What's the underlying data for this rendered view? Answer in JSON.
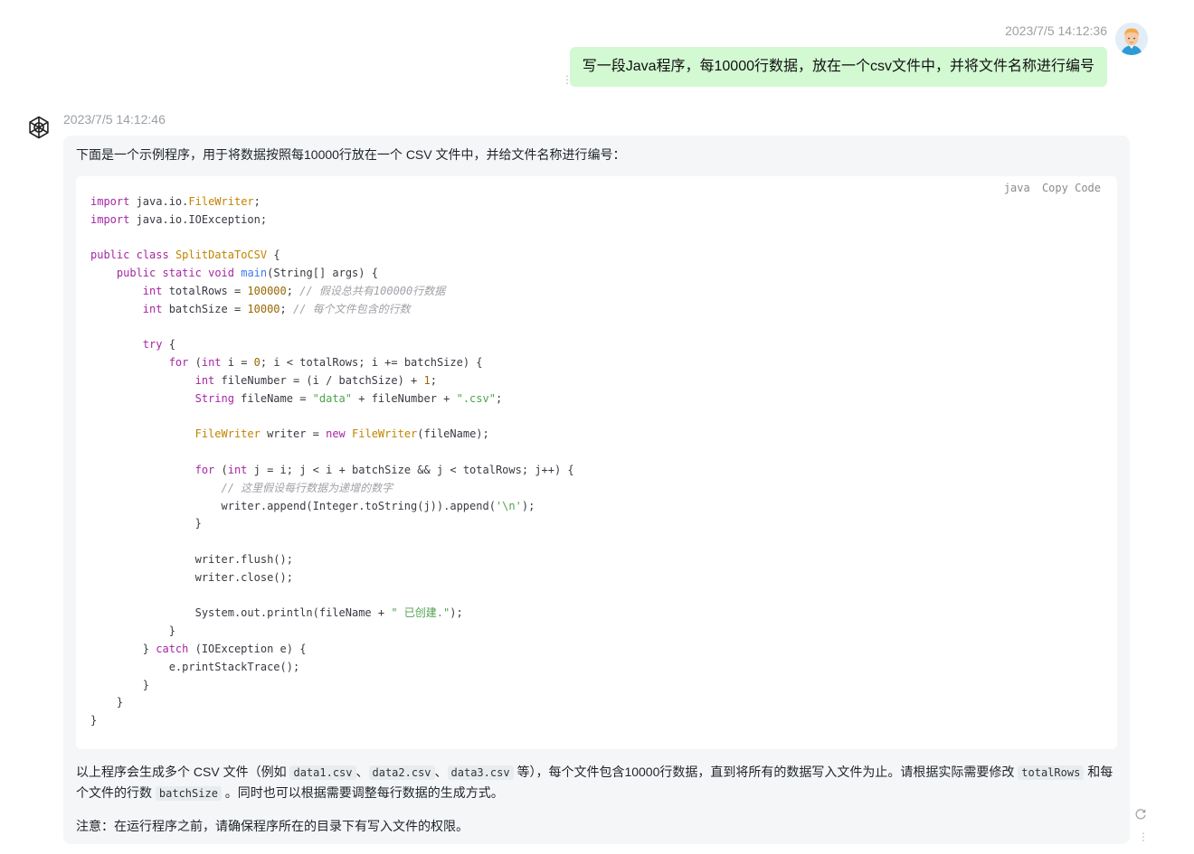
{
  "user_message": {
    "timestamp": "2023/7/5 14:12:36",
    "text": "写一段Java程序，每10000行数据，放在一个csv文件中，并将文件名称进行编号"
  },
  "assistant_message": {
    "timestamp": "2023/7/5 14:12:46",
    "intro": "下面是一个示例程序，用于将数据按照每10000行放在一个 CSV 文件中，并给文件名称进行编号：",
    "code": {
      "language": "java",
      "copy_label": "Copy",
      "code_label": "Code",
      "lines": [
        "import java.io.FileWriter;",
        "import java.io.IOException;",
        "",
        "public class SplitDataToCSV {",
        "    public static void main(String[] args) {",
        "        int totalRows = 100000; // 假设总共有100000行数据",
        "        int batchSize = 10000; // 每个文件包含的行数",
        "",
        "        try {",
        "            for (int i = 0; i < totalRows; i += batchSize) {",
        "                int fileNumber = (i / batchSize) + 1;",
        "                String fileName = \"data\" + fileNumber + \".csv\";",
        "",
        "                FileWriter writer = new FileWriter(fileName);",
        "",
        "                for (int j = i; j < i + batchSize && j < totalRows; j++) {",
        "                    // 这里假设每行数据为递增的数字",
        "                    writer.append(Integer.toString(j)).append('\\n');",
        "                }",
        "",
        "                writer.flush();",
        "                writer.close();",
        "",
        "                System.out.println(fileName + \" 已创建.\");",
        "            }",
        "        } catch (IOException e) {",
        "            e.printStackTrace();",
        "        }",
        "    }",
        "}"
      ]
    },
    "summary": {
      "t1": "以上程序会生成多个 CSV 文件（例如 ",
      "c1": "data1.csv",
      "sep1": "、",
      "c2": "data2.csv",
      "sep2": "、",
      "c3": "data3.csv",
      "t2": " 等），每个文件包含10000行数据，直到将所有的数据写入文件为止。请根据实际需要修改 ",
      "c4": "totalRows",
      "t3": " 和每个文件的行数 ",
      "c5": "batchSize",
      "t4": " 。同时也可以根据需要调整每行数据的生成方式。"
    },
    "note": "注意：在运行程序之前，请确保程序所在的目录下有写入文件的权限。"
  },
  "icons": {
    "user_avatar": "user-avatar",
    "assistant_logo": "openai-logo-icon",
    "refresh": "refresh-icon",
    "more": "more-vertical-icon"
  }
}
